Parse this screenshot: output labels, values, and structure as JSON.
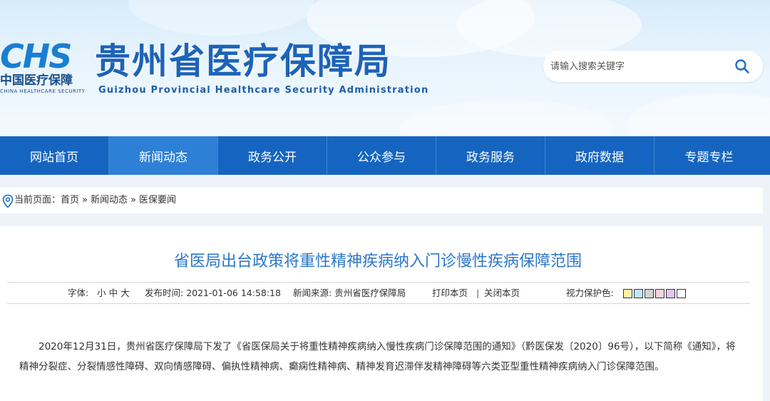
{
  "header": {
    "logo_mark": "CHS",
    "logo_cn": "中国医疗保障",
    "logo_en": "CHINA HEALTHCARE SECURITY",
    "title": "贵州省医疗保障局",
    "subtitle": "Guizhou Provincial Healthcare Security Administration",
    "search_placeholder": "请输入搜索关键字",
    "search_icon": "search-icon"
  },
  "nav": {
    "items": [
      {
        "label": "网站首页"
      },
      {
        "label": "新闻动态"
      },
      {
        "label": "政务公开"
      },
      {
        "label": "公众参与"
      },
      {
        "label": "政务服务"
      },
      {
        "label": "政府数据"
      },
      {
        "label": "专题专栏"
      }
    ],
    "active_index": 1
  },
  "breadcrumb": {
    "prefix": "当前页面：",
    "items": [
      "首页",
      "新闻动态",
      "医保要闻"
    ],
    "separator": "»",
    "icon": "location-pin-icon"
  },
  "article": {
    "title": "省医局出台政策将重性精神疾病纳入门诊慢性疾病保障范围",
    "meta": {
      "font_size_label": "字体:",
      "font_sizes": [
        "小",
        "中",
        "大"
      ],
      "publish_label": "发布时间:",
      "publish_time": "2021-01-06 14:58:18",
      "source_label": "新闻来源:",
      "source": "贵州省医疗保障局",
      "print": "打印本页",
      "divider": "|",
      "close": "关闭本页",
      "vision_label": "视力保护色:",
      "vision_colors": [
        "#fdf5a6",
        "#bfe6f7",
        "#d4d4d4",
        "#f8d3e2",
        "#e3c6f2",
        "#ffffff"
      ]
    },
    "body": "2020年12月31日，贵州省医疗保障局下发了《省医保局关于将重性精神疾病纳入慢性疾病门诊保障范围的通知》（黔医保发〔2020〕96号），以下简称《通知》，将精神分裂症、分裂情感性障碍、双向情感障碍、偏执性精神病、癫痫性精神病、精神发育迟滞伴发精神障碍等六类亚型重性精神疾病纳入门诊保障范围。"
  },
  "colors": {
    "nav_bg": "#1565c0",
    "nav_active": "#2e7fd6",
    "title_blue": "#1d63b8",
    "article_title": "#2c78c9"
  }
}
